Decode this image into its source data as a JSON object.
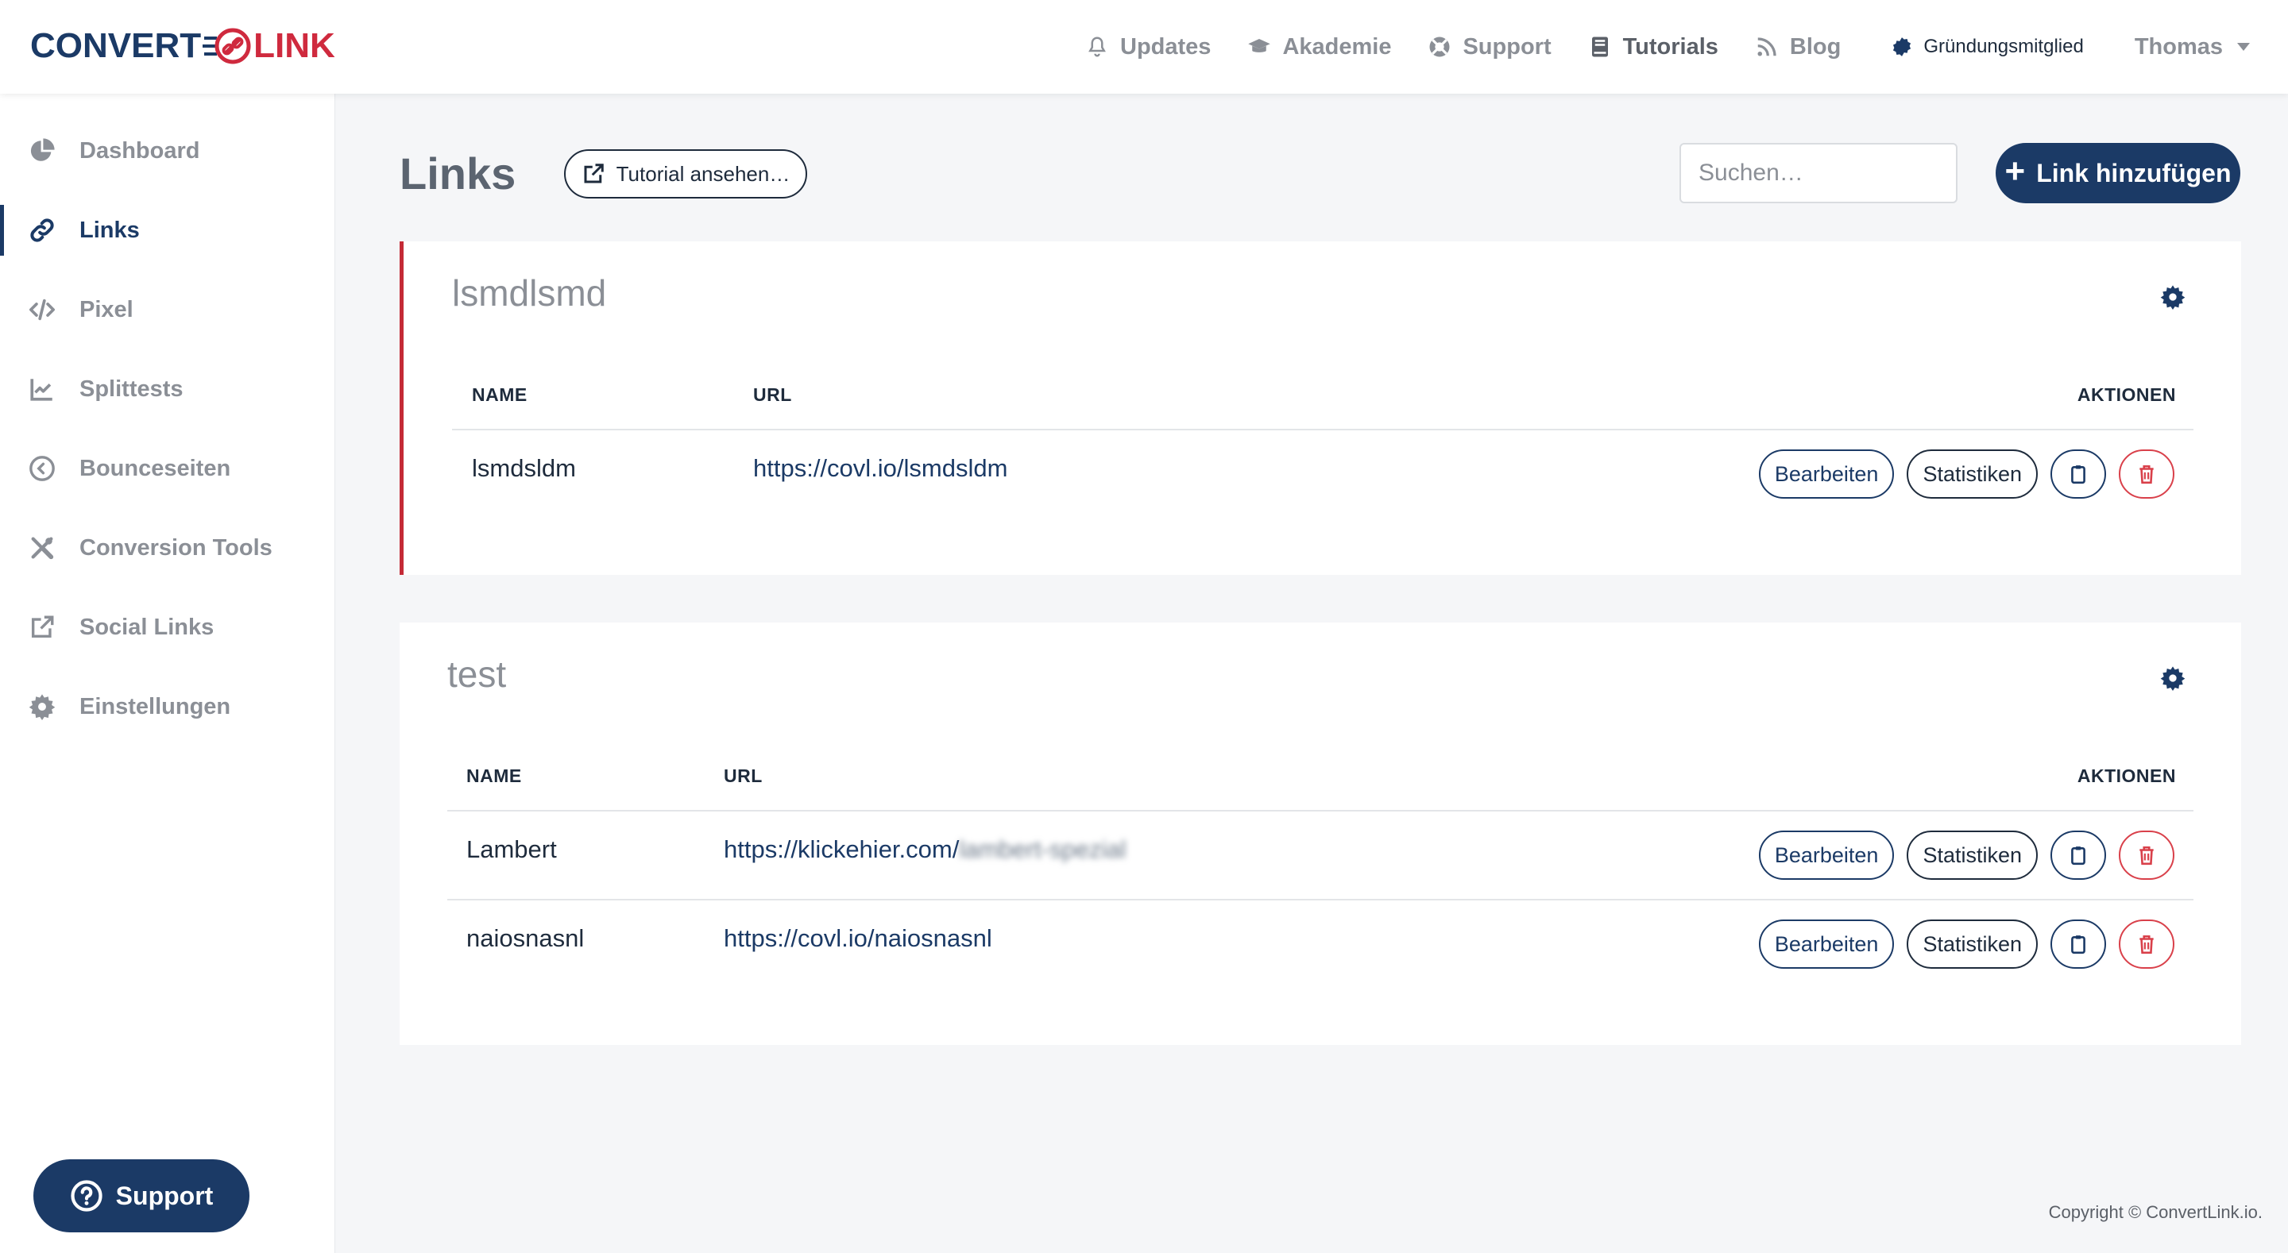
{
  "brand": {
    "part1": "CONVERT",
    "part2": "LINK",
    "primary": "#1b3a66",
    "accent": "#cf2a3e"
  },
  "topnav": {
    "items": [
      {
        "label": "Updates",
        "icon": "bell-icon"
      },
      {
        "label": "Akademie",
        "icon": "graduation-cap-icon"
      },
      {
        "label": "Support",
        "icon": "lifebuoy-icon"
      },
      {
        "label": "Tutorials",
        "icon": "book-icon"
      },
      {
        "label": "Blog",
        "icon": "rss-icon"
      }
    ],
    "member_label": "Gründungsmitglied",
    "user_name": "Thomas"
  },
  "sidebar": {
    "items": [
      {
        "label": "Dashboard",
        "icon": "pie-chart-icon"
      },
      {
        "label": "Links",
        "icon": "link-icon",
        "active": true
      },
      {
        "label": "Pixel",
        "icon": "code-icon"
      },
      {
        "label": "Splittests",
        "icon": "line-chart-icon"
      },
      {
        "label": "Bounceseiten",
        "icon": "arrow-circle-left-icon"
      },
      {
        "label": "Conversion Tools",
        "icon": "tools-icon"
      },
      {
        "label": "Social Links",
        "icon": "external-link-icon"
      },
      {
        "label": "Einstellungen",
        "icon": "gear-icon"
      }
    ],
    "support_button": "Support"
  },
  "main": {
    "title": "Links",
    "tutorial_button": "Tutorial ansehen…",
    "search_placeholder": "Suchen…",
    "add_button": "Link hinzufügen"
  },
  "groups": [
    {
      "title": "lsmdlsmd",
      "columns": {
        "name": "NAME",
        "url": "URL",
        "actions": "AKTIONEN"
      },
      "rows": [
        {
          "name": "lsmdsldm",
          "url": "https://covl.io/lsmdsldm",
          "url_hidden": ""
        }
      ]
    },
    {
      "title": "test",
      "columns": {
        "name": "NAME",
        "url": "URL",
        "actions": "AKTIONEN"
      },
      "rows": [
        {
          "name": "Lambert",
          "url": "https://klickehier.com/",
          "url_hidden": "lambert-spezial"
        },
        {
          "name": "naiosnasnl",
          "url": "https://covl.io/naiosnasnl",
          "url_hidden": ""
        }
      ]
    }
  ],
  "row_actions": {
    "edit": "Bearbeiten",
    "stats": "Statistiken"
  },
  "footer": {
    "copyright": "Copyright © ConvertLink.io."
  }
}
